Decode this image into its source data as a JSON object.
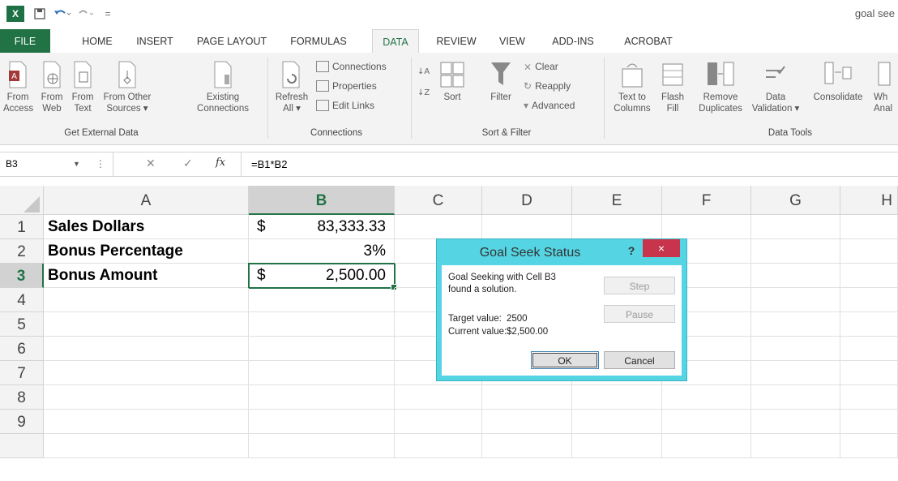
{
  "window": {
    "title": "goal see"
  },
  "quick_access": {
    "excel_logo": "X",
    "save_icon": "save-icon",
    "undo_icon": "undo-icon",
    "redo_icon": "redo-icon"
  },
  "tabs": [
    {
      "label": "FILE"
    },
    {
      "label": "HOME"
    },
    {
      "label": "INSERT"
    },
    {
      "label": "PAGE LAYOUT"
    },
    {
      "label": "FORMULAS"
    },
    {
      "label": "DATA"
    },
    {
      "label": "REVIEW"
    },
    {
      "label": "VIEW"
    },
    {
      "label": "ADD-INS"
    },
    {
      "label": "ACROBAT"
    }
  ],
  "ribbon": {
    "get_external": {
      "from_access": [
        "From",
        "Access"
      ],
      "from_web": [
        "From",
        "Web"
      ],
      "from_text": [
        "From",
        "Text"
      ],
      "from_other": [
        "From Other",
        "Sources ▾"
      ],
      "existing": [
        "Existing",
        "Connections"
      ],
      "label": "Get External Data"
    },
    "connections": {
      "refresh": [
        "Refresh",
        "All ▾"
      ],
      "connections": "Connections",
      "properties": "Properties",
      "edit_links": "Edit Links",
      "label": "Connections"
    },
    "sort_filter": {
      "sort": "Sort",
      "filter": "Filter",
      "clear": "Clear",
      "reapply": "Reapply",
      "advanced": "Advanced",
      "label": "Sort & Filter"
    },
    "data_tools": {
      "text_to_columns": [
        "Text to",
        "Columns"
      ],
      "flash_fill": [
        "Flash",
        "Fill"
      ],
      "remove_dup": [
        "Remove",
        "Duplicates"
      ],
      "data_validation": [
        "Data",
        "Validation ▾"
      ],
      "consolidate": "Consolidate",
      "what_if": [
        "Wh",
        "Anal"
      ],
      "label": "Data Tools"
    }
  },
  "formula_bar": {
    "name_box": "B3",
    "fx": "fx",
    "formula": "=B1*B2"
  },
  "grid": {
    "columns": [
      "A",
      "B",
      "C",
      "D",
      "E",
      "F",
      "G",
      "H"
    ],
    "rows": [
      "1",
      "2",
      "3",
      "4",
      "5",
      "6",
      "7",
      "8",
      "9"
    ],
    "cells": {
      "A1": "Sales Dollars",
      "A2": "Bonus Percentage",
      "A3": "Bonus Amount",
      "B1_currency": "$",
      "B1_value": "83,333.33",
      "B2_value": "3%",
      "B3_currency": "$",
      "B3_value": "2,500.00"
    }
  },
  "dialog": {
    "title": "Goal Seek Status",
    "help": "?",
    "close": "×",
    "message_line1": "Goal Seeking with Cell B3",
    "message_line2": "found a solution.",
    "target_label": "Target value:",
    "target_value": "2500",
    "current_label": "Current value:",
    "current_value": "$2,500.00",
    "step": "Step",
    "pause": "Pause",
    "ok": "OK",
    "cancel": "Cancel"
  }
}
